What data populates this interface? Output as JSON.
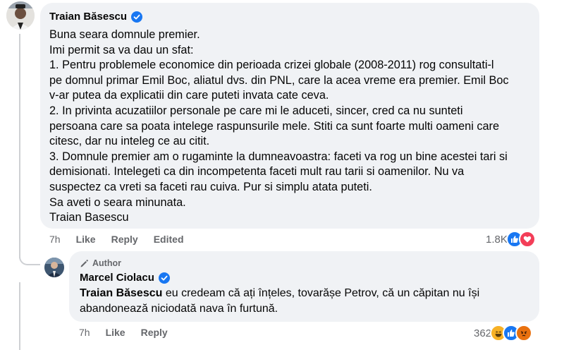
{
  "comment": {
    "author": "Traian Băsescu",
    "lines": [
      "Buna seara domnule premier.",
      "Imi permit sa va dau un sfat:",
      "1. Pentru problemele economice din perioada crizei globale (2008-2011) rog consultati-l",
      "pe domnul primar Emil Boc, aliatul dvs. din PNL, care la acea vreme era premier. Emil Boc",
      "v-ar putea da explicatii din care puteti invata cate ceva.",
      "2. In privinta acuzatiilor personale pe care mi le aduceti, sincer, cred ca nu sunteti",
      "persoana care sa poata intelege raspunsurile mele. Stiti ca sunt foarte multi oameni care",
      "citesc, dar nu inteleg ce au citit.",
      "3. Domnule premier am o rugaminte la dumneavoastra: faceti va rog un bine acestei tari si",
      "demisionati. Intelegeti ca din incompetenta faceti mult rau tarii si oamenilor. Nu va",
      "suspectez ca vreti sa faceti rau cuiva. Pur si simplu atata puteti.",
      "Sa aveti o seara minunata.",
      "Traian Basescu"
    ],
    "time": "7h",
    "like_label": "Like",
    "reply_label": "Reply",
    "edited_label": "Edited",
    "reaction_count": "1.8K",
    "reaction_icons": [
      "like-icon",
      "love-icon"
    ]
  },
  "reply": {
    "badge": "Author",
    "author": "Marcel Ciolacu",
    "mention": "Traian Băsescu",
    "text_line1": " eu credeam că ați înțeles, tovarășe Petrov, că un căpitan nu își",
    "text_line2": "abandonează niciodată nava în furtună.",
    "time": "7h",
    "like_label": "Like",
    "reply_label": "Reply",
    "reaction_count": "362",
    "reaction_icons": [
      "haha-icon",
      "like-icon",
      "angry-icon"
    ]
  },
  "colors": {
    "bubble": "#f0f2f5",
    "like_blue": "#1877f2",
    "love_red": "#f33e58",
    "haha_yellow": "#f7b125",
    "angry_orange": "#e9710f",
    "meta_gray": "#65676b"
  }
}
